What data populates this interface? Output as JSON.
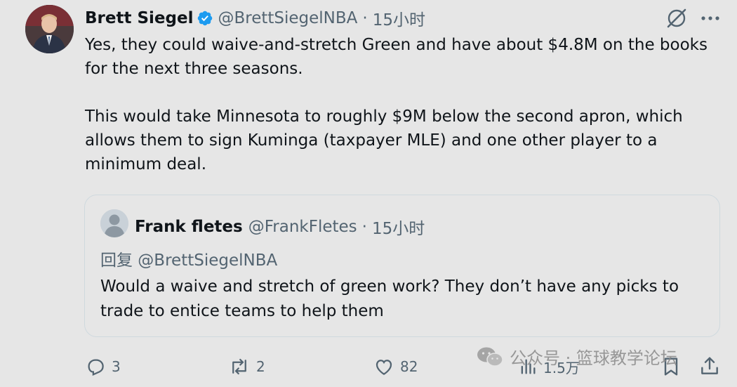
{
  "tweet": {
    "author_name": "Brett Siegel",
    "author_handle": "@BrettSiegelNBA",
    "separator": "·",
    "timestamp": "15小时",
    "paragraph_1": "Yes, they could waive-and-stretch Green and have about $4.8M on the books for the next three seasons.",
    "paragraph_2": "This would take Minnesota to roughly $9M below the second apron, which allows them to sign Kuminga (taxpayer MLE) and one other player to a minimum deal."
  },
  "quoted": {
    "author_name": "Frank fletes",
    "author_handle": "@FrankFletes",
    "separator": "·",
    "timestamp": "15小时",
    "reply_to": "回复 @BrettSiegelNBA",
    "text": "Would a waive and stretch of green work? They don’t have any picks to trade to entice teams to help them"
  },
  "actions": {
    "replies": "3",
    "reposts": "2",
    "likes": "82",
    "views": "1.5万"
  },
  "watermark": {
    "text": "公众号 · 篮球教学论坛"
  },
  "colors": {
    "background": "#e6e6e6",
    "text": "#0f1419",
    "muted": "#536471",
    "verified": "#1d9bf0"
  },
  "icons": [
    "verified-badge-icon",
    "grok-icon",
    "more-icon",
    "reply-icon",
    "repost-icon",
    "like-icon",
    "views-icon",
    "bookmark-icon",
    "share-icon",
    "wechat-icon"
  ]
}
